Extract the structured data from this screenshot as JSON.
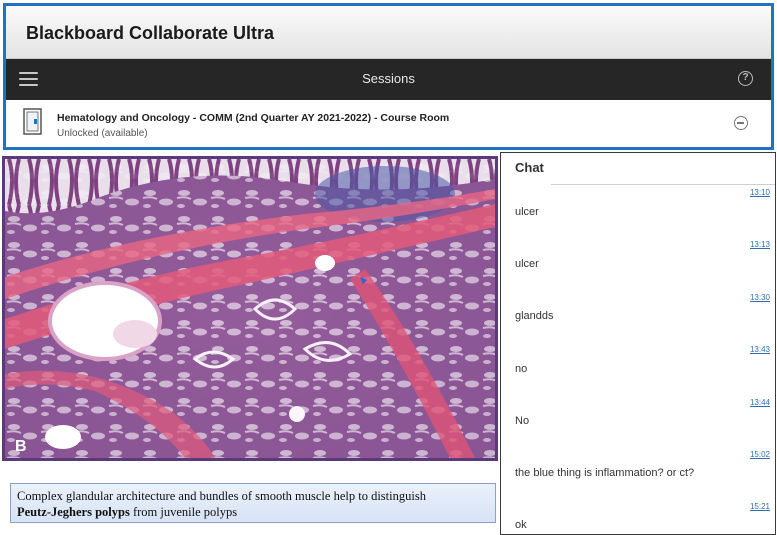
{
  "app": {
    "title": "Blackboard Collaborate Ultra",
    "nav_title": "Sessions",
    "help_symbol": "?",
    "session": {
      "name": "Hematology and Oncology - COMM (2nd Quarter AY 2021-2022) - Course Room",
      "status": "Unlocked (available)"
    },
    "accent_color": "#1f73c6"
  },
  "slide": {
    "corner_label": "B",
    "caption_prefix": "Complex glandular architecture and bundles of smooth muscle help to distinguish",
    "caption_bold": "Peutz-Jeghers polyps",
    "caption_suffix": " from juvenile polyps"
  },
  "chat": {
    "title": "Chat",
    "messages": [
      {
        "time": "13:10",
        "text": "ulcer"
      },
      {
        "time": "13:13",
        "text": "ulcer"
      },
      {
        "time": "13:30",
        "text": "glandds"
      },
      {
        "time": "13:43",
        "text": "no"
      },
      {
        "time": "13:44",
        "text": "No"
      },
      {
        "time": "15:02",
        "text": "the blue thing is inflammation? or ct?"
      },
      {
        "time": "15:21",
        "text": "ok"
      }
    ]
  }
}
